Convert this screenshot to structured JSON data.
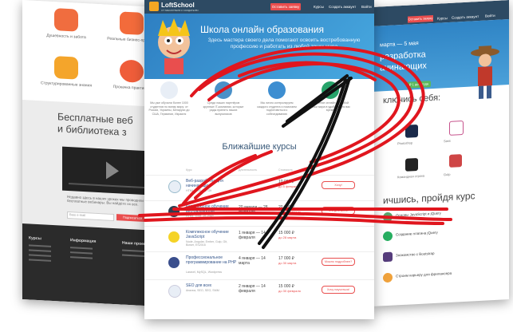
{
  "left_page": {
    "cards": [
      "Душевность и забота",
      "Реальные бизнес-проекты",
      "Структурированные знания",
      "Прокачка практикой"
    ],
    "free_title_line1": "Бесплатные веб",
    "free_title_line2": "и библиотека з",
    "video_note": "Недавно здесь в наших уроках мы проводили бесплатные вебинары. Вы найдёте их все.",
    "email_placeholder": "Ваш e-mail",
    "subscribe_label": "Подписаться",
    "footer_headings": [
      "Курсы",
      "Информация",
      "Наши проекты"
    ]
  },
  "right_page": {
    "nav_button": "Оставить заявку",
    "nav_links": [
      "Курсы",
      "Создать аккаунт",
      "Войти"
    ],
    "hero_line1": "марта — 5 мая",
    "hero_line2": "разработка",
    "hero_line3": "ачинающих",
    "hero_button": "₽ 1 до 1 года",
    "section_title": "ключись себя:",
    "tools": [
      "Photoshop",
      "Sass",
      "Командная строка",
      "Gulp"
    ],
    "course_title": "ичшись, пройдя курс",
    "course_items": [
      "Основы JavaScript и jQuery",
      "Создание плагина jQuery",
      "Знакомство с Bootstrap",
      "Строим карьеру для фрилансера"
    ]
  },
  "center_page": {
    "logo_title": "LoftSchool",
    "logo_sub": "ОТ МЫСЛИТЕЛЯ К СОЗДАТЕЛЮ",
    "nav_button": "Оставить заявку",
    "nav_links": [
      "Курсы",
      "Создать аккаунт",
      "Войти"
    ],
    "hero_title": "Школа онлайн образования",
    "hero_desc": "Здесь мастера своего дела помогают освоить востребованную профессию и работать из любой точки мира",
    "features": [
      "Мы уже обучили более 1000 студентов по всему миру: от России, Украины, Беларуси до США, Германии, Израиля",
      "Среди наших партнёров крупные IT-компании, которые рады принять наших выпускников",
      "Мы лично контролируем каждого студента и помогаем подготовиться к собеседованию",
      "Обучение онлайн из любой точки мира в удобное для вас время"
    ],
    "near_title": "Ближайшие курсы",
    "table_headers": [
      "Курс",
      "Длительность",
      "Стоимость"
    ],
    "courses": [
      {
        "title": "Веб-разработка для начинающих",
        "sub": "HTML, CSS, JS, Git",
        "dates": "",
        "price": "10 000 ₽",
        "discount": "до 5 февраля",
        "action": "Хочу!"
      },
      {
        "title": "Комплексное обучение веб-разработке",
        "sub": "HTML, CSS, JS, PHP",
        "dates": "20 января — 28 февраля",
        "price": "20 000 ₽",
        "discount": "до 20 февраля",
        "action": "Это для меня!"
      },
      {
        "title": "Комплексное обучение JavaScript",
        "sub": "Node, Angular, Ember, Gulp, Git, Bower, ES2016",
        "dates": "1 января — 14 февраля",
        "price": "15 000 ₽",
        "discount": "до 28 марта",
        "action": ""
      },
      {
        "title": "Профессиональное программирование на PHP",
        "sub": "Laravel, MySQL, Wordpress",
        "dates": "4 января — 14 марта",
        "price": "17 000 ₽",
        "discount": "до 30 марта",
        "action": "Можно подробнее?"
      },
      {
        "title": "SEO для всех",
        "sub": "Анализ, SEO, SEO, SMM",
        "dates": "2 января — 14 февраля",
        "price": "15 000 ₽",
        "discount": "до 30 февраля",
        "action": "Хочу научиться!"
      }
    ]
  },
  "colors": {
    "nav": "#2d4a63",
    "accent": "#e94e4e",
    "hero": "#2e7fc2",
    "scribble_red": "#e0161e",
    "scribble_black": "#111111"
  }
}
